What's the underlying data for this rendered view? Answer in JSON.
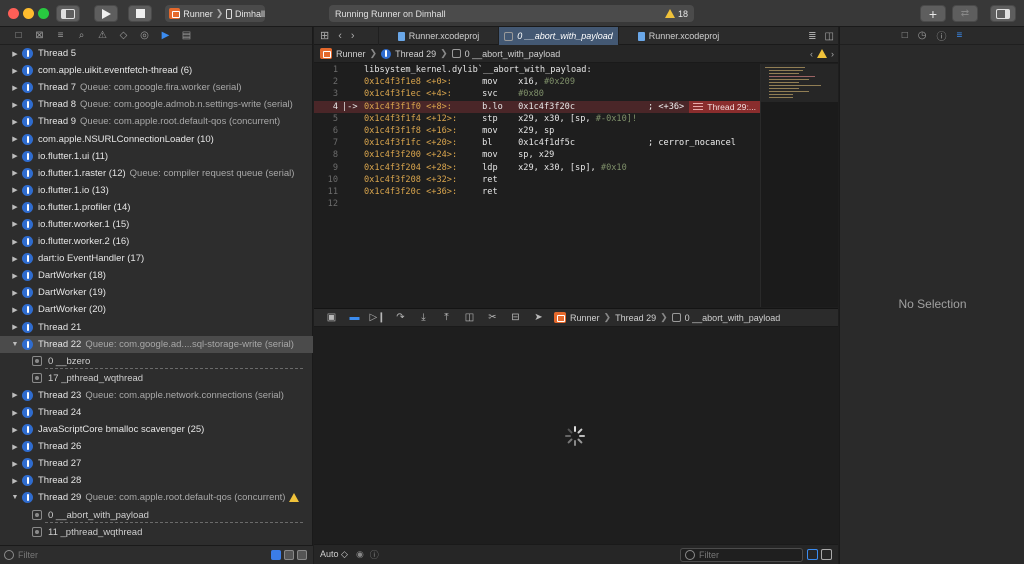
{
  "toolbar": {
    "scheme_app": "Runner",
    "scheme_device": "Dimhall",
    "status_text": "Running Runner on Dimhall",
    "warning_count": "18"
  },
  "navigator": {
    "threads": [
      {
        "name": "Thread 5",
        "queue": "",
        "expanded": false
      },
      {
        "name": "com.apple.uikit.eventfetch-thread (6)",
        "queue": "",
        "expanded": false
      },
      {
        "name": "Thread 7",
        "queue": "Queue: com.google.fira.worker (serial)",
        "expanded": false
      },
      {
        "name": "Thread 8",
        "queue": "Queue: com.google.admob.n.settings-write (serial)",
        "expanded": false
      },
      {
        "name": "Thread 9",
        "queue": "Queue: com.apple.root.default-qos (concurrent)",
        "expanded": false
      },
      {
        "name": "com.apple.NSURLConnectionLoader (10)",
        "queue": "",
        "expanded": false
      },
      {
        "name": "io.flutter.1.ui (11)",
        "queue": "",
        "expanded": false
      },
      {
        "name": "io.flutter.1.raster (12)",
        "queue": "Queue: compiler request queue (serial)",
        "expanded": false
      },
      {
        "name": "io.flutter.1.io (13)",
        "queue": "",
        "expanded": false
      },
      {
        "name": "io.flutter.1.profiler (14)",
        "queue": "",
        "expanded": false
      },
      {
        "name": "io.flutter.worker.1 (15)",
        "queue": "",
        "expanded": false
      },
      {
        "name": "io.flutter.worker.2 (16)",
        "queue": "",
        "expanded": false
      },
      {
        "name": "dart:io EventHandler (17)",
        "queue": "",
        "expanded": false
      },
      {
        "name": "DartWorker (18)",
        "queue": "",
        "expanded": false
      },
      {
        "name": "DartWorker (19)",
        "queue": "",
        "expanded": false
      },
      {
        "name": "DartWorker (20)",
        "queue": "",
        "expanded": false
      },
      {
        "name": "Thread 21",
        "queue": "",
        "expanded": false
      },
      {
        "name": "Thread 22",
        "queue": "Queue: com.google.ad....sql-storage-write (serial)",
        "expanded": true,
        "selected": true,
        "frames": [
          "0 __bzero",
          "17 _pthread_wqthread"
        ]
      },
      {
        "name": "Thread 23",
        "queue": "Queue: com.apple.network.connections (serial)",
        "expanded": false
      },
      {
        "name": "Thread 24",
        "queue": "",
        "expanded": false
      },
      {
        "name": "JavaScriptCore bmalloc scavenger (25)",
        "queue": "",
        "expanded": false
      },
      {
        "name": "Thread 26",
        "queue": "",
        "expanded": false
      },
      {
        "name": "Thread 27",
        "queue": "",
        "expanded": false
      },
      {
        "name": "Thread 28",
        "queue": "",
        "expanded": false
      },
      {
        "name": "Thread 29",
        "queue": "Queue: com.apple.root.default-qos (concurrent)",
        "expanded": true,
        "warning": true,
        "frames": [
          "0 __abort_with_payload",
          "11 _pthread_wqthread"
        ]
      }
    ],
    "filter_placeholder": "Filter"
  },
  "editor": {
    "tabs": [
      {
        "label": "Runner.xcodeproj",
        "active": false
      },
      {
        "label": "0 __abort_with_payload",
        "active": true
      },
      {
        "label": "Runner.xcodeproj",
        "active": false
      }
    ],
    "jumpbar": [
      "Runner",
      "Thread 29",
      "0 __abort_with_payload"
    ],
    "code_lines": [
      {
        "n": "1",
        "addr": "",
        "off": "",
        "op": "",
        "args": "libsystem_kernel.dylib`__abort_with_payload:",
        "cmt": "",
        "plain": true
      },
      {
        "n": "2",
        "addr": "0x1c4f3f1e8",
        "off": "<+0>:",
        "op": "mov",
        "args": "x16, ",
        "cmt": "#0x209"
      },
      {
        "n": "3",
        "addr": "0x1c4f3f1ec",
        "off": "<+4>:",
        "op": "svc",
        "args": "",
        "cmt": "#0x80"
      },
      {
        "n": "4",
        "addr": "0x1c4f3f1f0",
        "off": "<+8>:",
        "op": "b.lo",
        "args": "0x1c4f3f20c",
        "cmt": "",
        "ctx": "; <+36>",
        "current": true
      },
      {
        "n": "5",
        "addr": "0x1c4f3f1f4",
        "off": "<+12>:",
        "op": "stp",
        "args": "x29, x30, [sp, ",
        "cmt": "#-0x10]!"
      },
      {
        "n": "6",
        "addr": "0x1c4f3f1f8",
        "off": "<+16>:",
        "op": "mov",
        "args": "x29, sp",
        "cmt": ""
      },
      {
        "n": "7",
        "addr": "0x1c4f3f1fc",
        "off": "<+20>:",
        "op": "bl",
        "args": "0x1c4f1df5c",
        "cmt": "",
        "ctx": "; cerror_nocancel"
      },
      {
        "n": "8",
        "addr": "0x1c4f3f200",
        "off": "<+24>:",
        "op": "mov",
        "args": "sp, x29",
        "cmt": ""
      },
      {
        "n": "9",
        "addr": "0x1c4f3f204",
        "off": "<+28>:",
        "op": "ldp",
        "args": "x29, x30, [sp], ",
        "cmt": "#0x10"
      },
      {
        "n": "10",
        "addr": "0x1c4f3f208",
        "off": "<+32>:",
        "op": "ret",
        "args": "",
        "cmt": ""
      },
      {
        "n": "11",
        "addr": "0x1c4f3f20c",
        "off": "<+36>:",
        "op": "ret",
        "args": "",
        "cmt": ""
      },
      {
        "n": "12",
        "addr": "",
        "off": "",
        "op": "",
        "args": "",
        "cmt": "",
        "plain": true
      }
    ],
    "pc_marker": "|->",
    "current_thread_badge": "Thread 29:..."
  },
  "debugbar": {
    "crumbs": [
      "Runner",
      "Thread 29",
      "0 __abort_with_payload"
    ]
  },
  "bottombar": {
    "mode": "Auto ◇",
    "filter_placeholder": "Filter"
  },
  "inspector": {
    "empty_text": "No Selection"
  },
  "colors": {
    "accent": "#3b8cf0",
    "thread_icon": "#2f6ccf",
    "current_line_bg": "#4a2628",
    "warning": "#f0c23a",
    "app_icon": "#e5692c"
  }
}
